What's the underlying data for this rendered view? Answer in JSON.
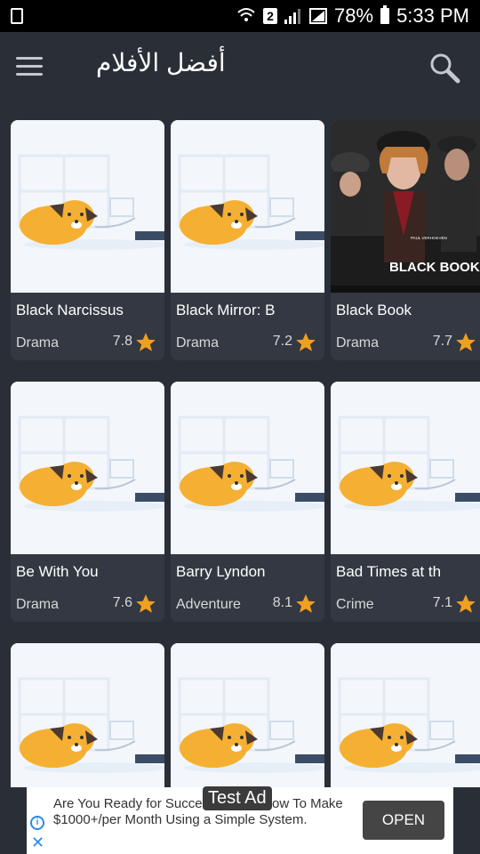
{
  "status": {
    "sim": "2",
    "battery": "78%",
    "time": "5:33 PM"
  },
  "appbar": {
    "title": "أفضل الأفلام"
  },
  "movies": [
    {
      "title": "Black Narcissus",
      "genre": "Drama",
      "rating": "7.8",
      "poster": "placeholder"
    },
    {
      "title": "Black Mirror: B",
      "genre": "Drama",
      "rating": "7.2",
      "poster": "placeholder"
    },
    {
      "title": "Black Book",
      "genre": "Drama",
      "rating": "7.7",
      "poster": "image"
    },
    {
      "title": "Be With You",
      "genre": "Drama",
      "rating": "7.6",
      "poster": "placeholder"
    },
    {
      "title": "Barry Lyndon",
      "genre": "Adventure",
      "rating": "8.1",
      "poster": "placeholder"
    },
    {
      "title": "Bad Times at th",
      "genre": "Crime",
      "rating": "7.1",
      "poster": "placeholder"
    },
    {
      "title": "",
      "genre": "",
      "rating": "",
      "poster": "placeholder"
    },
    {
      "title": "",
      "genre": "",
      "rating": "",
      "poster": "placeholder"
    },
    {
      "title": "",
      "genre": "",
      "rating": "",
      "poster": "placeholder"
    }
  ],
  "poster_text": {
    "black_book": "BLACK BOOK",
    "director": "PAUL VERHOEVEN"
  },
  "ad": {
    "badge": "Test Ad",
    "text": "Are You Ready for Success? Learn how To Make $1000+/per Month Using a Simple System.",
    "open_label": "OPEN"
  },
  "colors": {
    "background": "#2a2e37",
    "card": "#333842",
    "star": "#f0a01c",
    "placeholder_bg": "#f3f7fc",
    "mascot": "#f5b033"
  }
}
